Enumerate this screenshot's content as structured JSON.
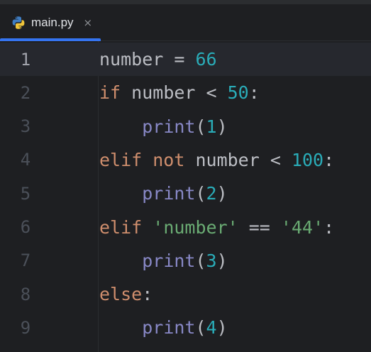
{
  "tab": {
    "filename": "main.py",
    "close_glyph": "×",
    "icon": "python-file-icon"
  },
  "colors": {
    "background": "#1e1f22",
    "current_line": "#26282e",
    "keyword": "#cf8e6d",
    "number": "#2aacb8",
    "builtin": "#8888c6",
    "string": "#6aab73",
    "identifier": "#bcbec4",
    "tab_underline": "#3574f0"
  },
  "lines": [
    {
      "n": "1",
      "t": [
        [
          "id",
          "number"
        ],
        [
          "op",
          " = "
        ],
        [
          "num",
          "66"
        ]
      ]
    },
    {
      "n": "2",
      "t": [
        [
          "kw",
          "if"
        ],
        [
          "op",
          " number < "
        ],
        [
          "num",
          "50"
        ],
        [
          "op",
          ":"
        ]
      ]
    },
    {
      "n": "3",
      "t": [
        [
          "op",
          "    "
        ],
        [
          "fn",
          "print"
        ],
        [
          "op",
          "("
        ],
        [
          "num",
          "1"
        ],
        [
          "op",
          ")"
        ]
      ]
    },
    {
      "n": "4",
      "t": [
        [
          "kw",
          "elif not"
        ],
        [
          "op",
          " number < "
        ],
        [
          "num",
          "100"
        ],
        [
          "op",
          ":"
        ]
      ]
    },
    {
      "n": "5",
      "t": [
        [
          "op",
          "    "
        ],
        [
          "fn",
          "print"
        ],
        [
          "op",
          "("
        ],
        [
          "num",
          "2"
        ],
        [
          "op",
          ")"
        ]
      ]
    },
    {
      "n": "6",
      "t": [
        [
          "kw",
          "elif"
        ],
        [
          "op",
          " "
        ],
        [
          "str",
          "'number'"
        ],
        [
          "op",
          " == "
        ],
        [
          "str",
          "'44'"
        ],
        [
          "op",
          ":"
        ]
      ]
    },
    {
      "n": "7",
      "t": [
        [
          "op",
          "    "
        ],
        [
          "fn",
          "print"
        ],
        [
          "op",
          "("
        ],
        [
          "num",
          "3"
        ],
        [
          "op",
          ")"
        ]
      ]
    },
    {
      "n": "8",
      "t": [
        [
          "kw",
          "else"
        ],
        [
          "op",
          ":"
        ]
      ]
    },
    {
      "n": "9",
      "t": [
        [
          "op",
          "    "
        ],
        [
          "fn",
          "print"
        ],
        [
          "op",
          "("
        ],
        [
          "num",
          "4"
        ],
        [
          "op",
          ")"
        ]
      ]
    }
  ]
}
